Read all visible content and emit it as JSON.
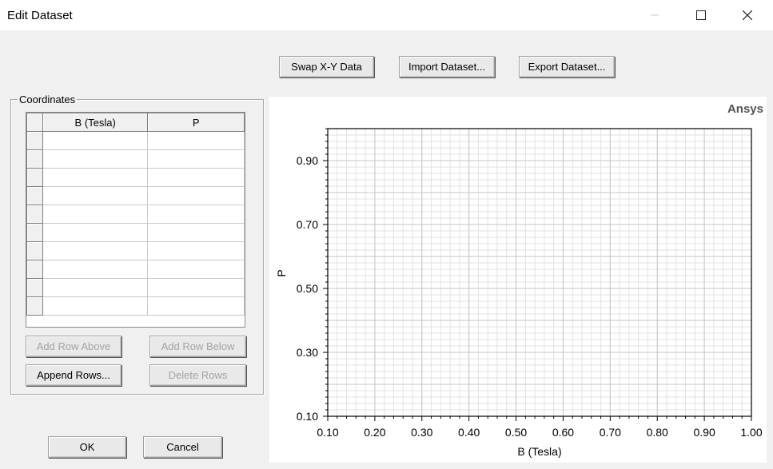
{
  "window": {
    "title": "Edit Dataset",
    "controls": [
      "minimize-icon",
      "maximize-icon",
      "close-icon"
    ]
  },
  "toolbar": {
    "swap_label": "Swap X-Y Data",
    "import_label": "Import Dataset...",
    "export_label": "Export Dataset..."
  },
  "coordinates": {
    "group_label": "Coordinates",
    "columns": [
      "B (Tesla)",
      "P"
    ],
    "rows": [
      [
        "",
        ""
      ],
      [
        "",
        ""
      ],
      [
        "",
        ""
      ],
      [
        "",
        ""
      ],
      [
        "",
        ""
      ],
      [
        "",
        ""
      ],
      [
        "",
        ""
      ],
      [
        "",
        ""
      ],
      [
        "",
        ""
      ],
      [
        "",
        ""
      ]
    ],
    "add_row_above_label": "Add Row Above",
    "add_row_below_label": "Add Row Below",
    "append_rows_label": "Append Rows...",
    "delete_rows_label": "Delete Rows"
  },
  "footer": {
    "ok_label": "OK",
    "cancel_label": "Cancel"
  },
  "chart_data": {
    "type": "line",
    "watermark": "Ansys",
    "xlabel": "B (Tesla)",
    "ylabel": "P",
    "xlim": [
      0.1,
      1.0
    ],
    "ylim": [
      0.1,
      1.0
    ],
    "x_ticks": [
      "0.10",
      "0.20",
      "0.30",
      "0.40",
      "0.50",
      "0.60",
      "0.70",
      "0.80",
      "0.90",
      "1.00"
    ],
    "y_ticks": [
      "0.10",
      "0.30",
      "0.50",
      "0.70",
      "0.90"
    ],
    "grid": true,
    "series": []
  }
}
